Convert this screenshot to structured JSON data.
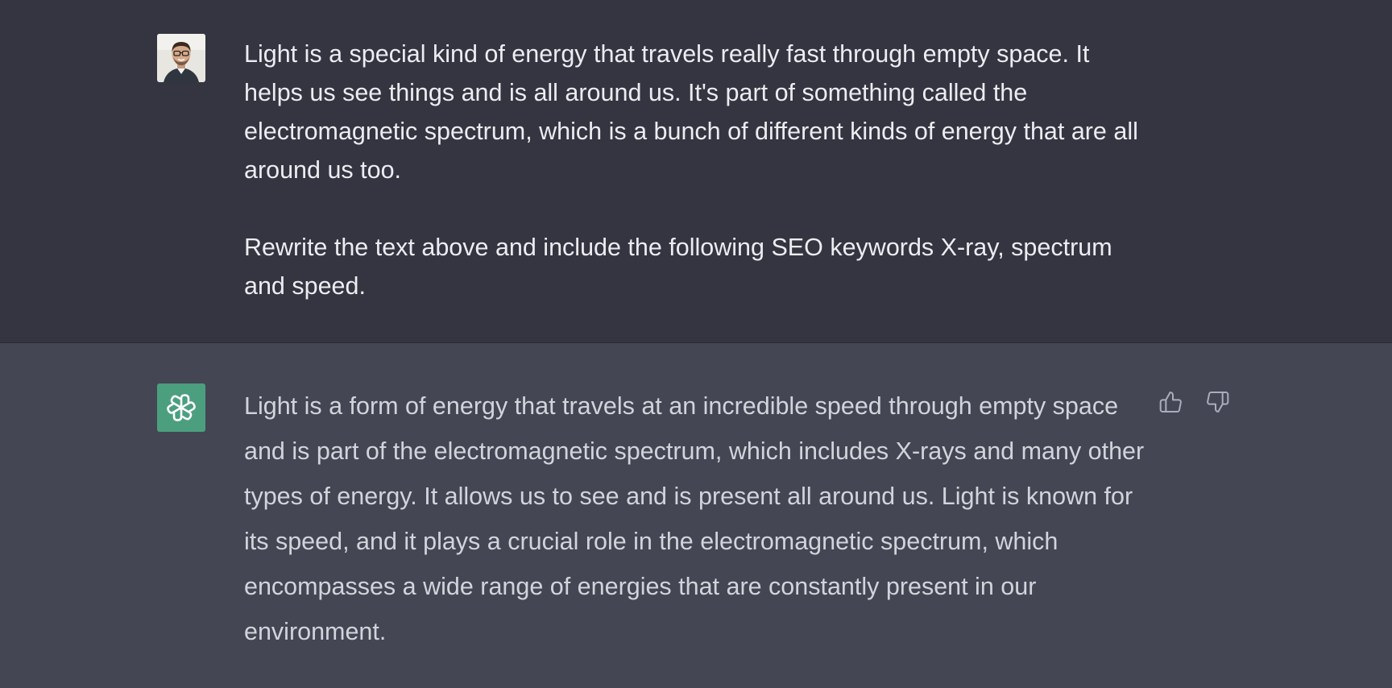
{
  "conversation": {
    "user_message": {
      "paragraph_1": "Light is a special kind of energy that travels really fast through empty space. It helps us see things and is all around us. It's part of something called the electromagnetic spectrum, which is a bunch of different kinds of energy that are all around us too.",
      "paragraph_2": "Rewrite the text above and include the following SEO keywords X-ray, spectrum and speed.",
      "avatar_icon": "user-photo-avatar"
    },
    "assistant_message": {
      "text": "Light is a form of energy that travels at an incredible speed through empty space and is part of the electromagnetic spectrum, which includes X-rays and many other types of energy. It allows us to see and is present all around us. Light is known for its speed, and it plays a crucial role in the electromagnetic spectrum, which encompasses a wide range of energies that are constantly present in our environment.",
      "avatar_icon": "openai-logo-icon",
      "feedback_icons": [
        "thumbs-up-icon",
        "thumbs-down-icon"
      ]
    }
  },
  "colors": {
    "user_bg": "#343541",
    "assistant_bg": "#444654",
    "assistant_avatar_bg": "#4b9f7f",
    "user_text": "#ececf1",
    "assistant_text": "#d1d5db",
    "icon": "#acacbe"
  }
}
